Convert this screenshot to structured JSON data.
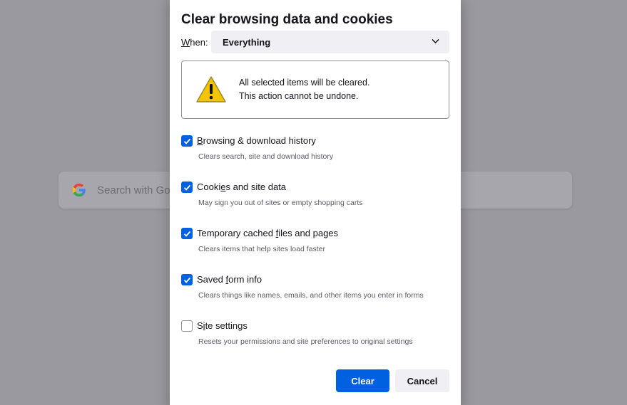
{
  "background": {
    "search_placeholder": "Search with Goo"
  },
  "dialog": {
    "title": "Clear browsing data and cookies",
    "when_label_prefix": "W",
    "when_label_rest": "hen:",
    "when_value": "Everything",
    "warning_line1": "All selected items will be cleared.",
    "warning_line2": "This action cannot be undone.",
    "options": [
      {
        "pre": "",
        "key": "B",
        "post": "rowsing & download history",
        "desc": "Clears search, site and download history",
        "checked": true
      },
      {
        "pre": "Cooki",
        "key": "e",
        "post": "s and site data",
        "desc": "May sign you out of sites or empty shopping carts",
        "checked": true
      },
      {
        "pre": "Temporary cached ",
        "key": "f",
        "post": "iles and pages",
        "desc": "Clears items that help sites load faster",
        "checked": true
      },
      {
        "pre": "Saved ",
        "key": "f",
        "post": "orm info",
        "desc": "Clears things like names, emails, and other items you enter in forms",
        "checked": true
      },
      {
        "pre": "S",
        "key": "i",
        "post": "te settings",
        "desc": "Resets your permissions and site preferences to original settings",
        "checked": false
      }
    ],
    "clear_label": "Clear",
    "cancel_label": "Cancel"
  },
  "colors": {
    "accent": "#0061e0",
    "warning_yellow": "#f5c400"
  }
}
